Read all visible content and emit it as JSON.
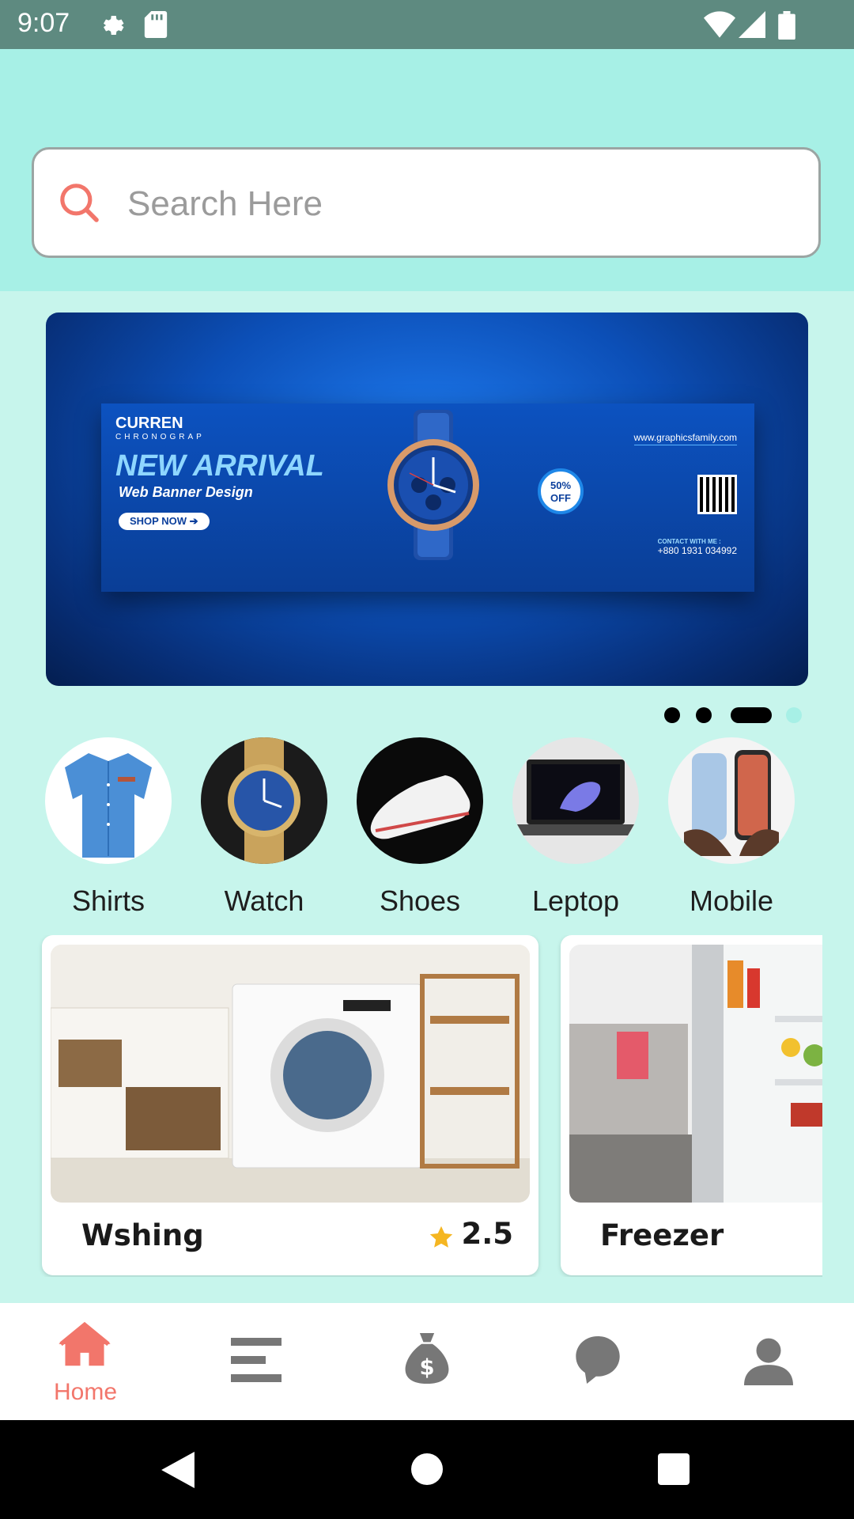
{
  "status_bar": {
    "time": "9:07",
    "icons": [
      "settings-icon",
      "sd-card-icon",
      "wifi-icon",
      "signal-icon",
      "battery-icon"
    ]
  },
  "search": {
    "placeholder": "Search Here",
    "icon": "search-icon"
  },
  "banner": {
    "brand": "CURREN",
    "brand_sub": "CHRONOGRAP",
    "headline": "NEW ARRIVAL",
    "subline": "Web Banner Design",
    "cta": "SHOP NOW",
    "discount_top": "50%",
    "discount_bottom": "OFF",
    "website": "www.graphicsfamily.com",
    "contact_label": "CONTACT WITH ME :",
    "contact_phone": "+880 1931 034992",
    "page_count": 4,
    "active_page": 3
  },
  "categories": [
    {
      "label": "Shirts",
      "icon": "shirt-image"
    },
    {
      "label": "Watch",
      "icon": "watch-image"
    },
    {
      "label": "Shoes",
      "icon": "shoe-image"
    },
    {
      "label": "Leptop",
      "icon": "laptop-image"
    },
    {
      "label": "Mobile",
      "icon": "mobile-image"
    }
  ],
  "products": [
    {
      "name": "Wshing",
      "rating": "2.5",
      "image": "washing-machine-image"
    },
    {
      "name": "Freezer",
      "image": "refrigerator-image"
    }
  ],
  "bottom_nav": {
    "active": "Home",
    "items": [
      {
        "label": "Home",
        "icon": "home-icon"
      },
      {
        "icon": "menu-icon"
      },
      {
        "icon": "money-bag-icon"
      },
      {
        "icon": "chat-icon"
      },
      {
        "icon": "profile-icon"
      }
    ]
  },
  "colors": {
    "accent": "#F2766B",
    "top_bg": "#A7F0E6",
    "page_bg": "#C7F5EC",
    "status_bar": "#5E8A80"
  }
}
